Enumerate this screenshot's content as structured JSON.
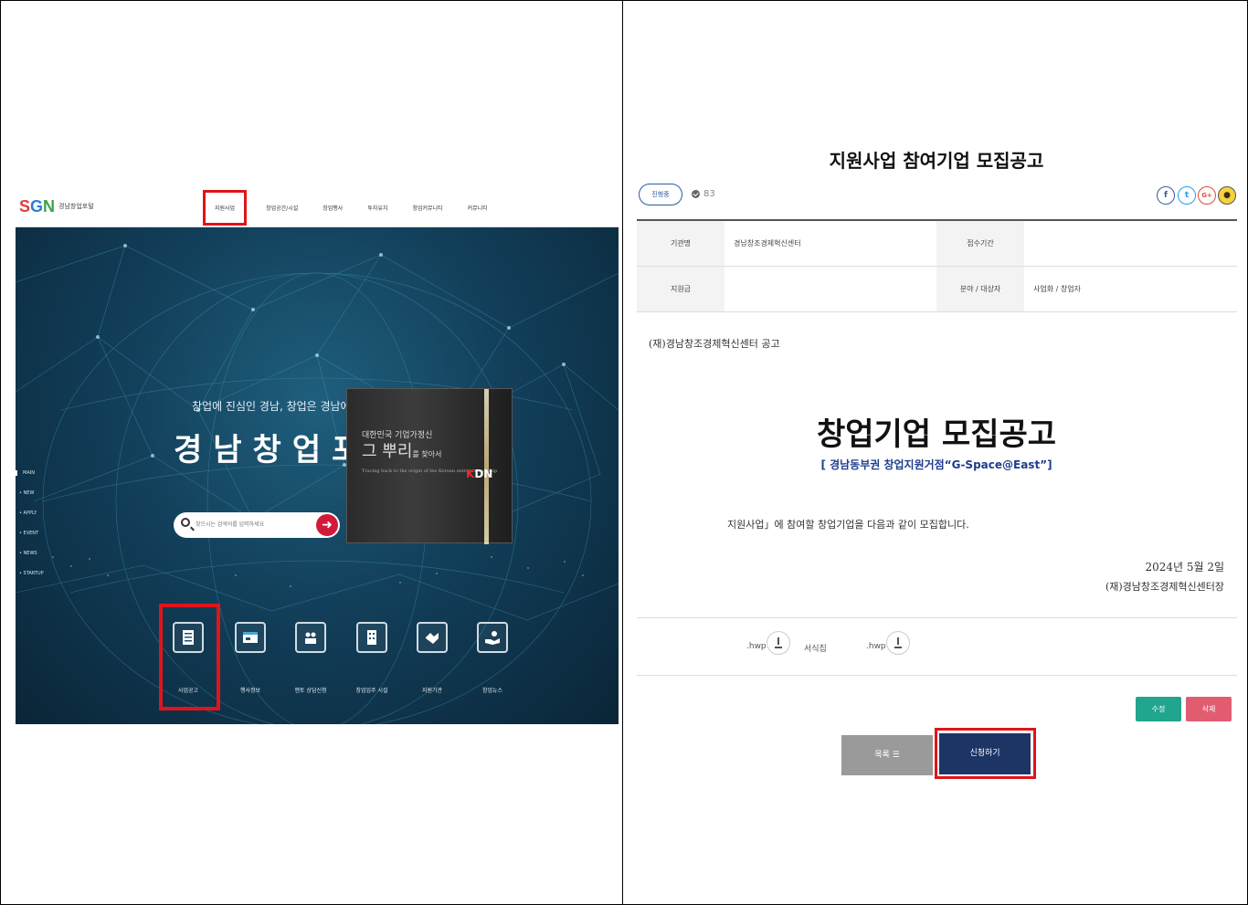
{
  "left": {
    "logo": {
      "mark": "SGN",
      "text": "경남창업포털"
    },
    "nav": [
      "지원사업",
      "창업공간/시설",
      "창업행사",
      "투자유치",
      "창업커뮤니티",
      "커뮤니티"
    ],
    "side_menu": [
      "MAIN",
      "NEW",
      "APPLY",
      "EVENT",
      "NEWS",
      "STARTUP"
    ],
    "hero": {
      "subtitle": "창업에 진심인 경남, 창업은 경남에서",
      "title": "경남창업포털",
      "search_placeholder": "찾으시는 검색어를 입력하세요",
      "photo": {
        "line1": "대한민국 기업가정신",
        "line2": "그 뿌리",
        "line3": "를 찾아서",
        "small": "Tracing back to the origin of the Korean entrepreneurship",
        "brand": "KDN"
      }
    },
    "quick_links": [
      "사업공고",
      "행사정보",
      "멘토 상담신청",
      "창업입주 시설",
      "지원기관",
      "창업뉴스"
    ]
  },
  "right": {
    "title": "지원사업 참여기업 모집공고",
    "status": "진행중",
    "views": "83",
    "share": {
      "facebook": "f",
      "twitter": "t",
      "google": "G+",
      "kakao": "●"
    },
    "table": {
      "row1": {
        "h1": "기관명",
        "v1": "경남창조경제혁신센터",
        "h2": "접수기간",
        "v2": ""
      },
      "row2": {
        "h1": "지원금",
        "v1": "",
        "h2": "분야 / 대상자",
        "v2": "사업화 / 창업자"
      }
    },
    "body": {
      "line1": "(재)경남창조경제혁신센터 공고",
      "notice_title": "창업기업 모집공고",
      "notice_sub": "[ 경남동부권 창업지원거점“G-Space@East”]",
      "line2": "지원사업」에 참여할 창업기업을 다음과 같이 모집합니다.",
      "date": "2024년 5월 2일",
      "sign": "(재)경남창조경제혁신센터장"
    },
    "attachments": {
      "file1": ".hwp",
      "file2_prefix": "서식집",
      "file2": ".hwp"
    },
    "buttons": {
      "edit": "수정",
      "delete": "삭제",
      "list": "목록 ☰",
      "apply": "신청하기"
    }
  }
}
